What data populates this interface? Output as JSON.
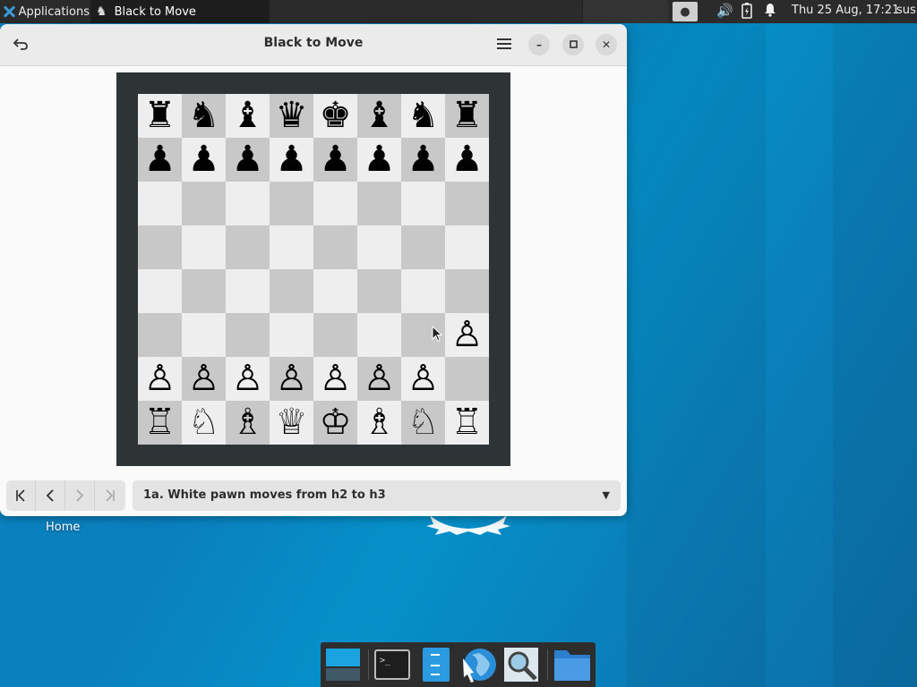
{
  "top_panel": {
    "applications_label": "Applications",
    "task_title": "Black to Move",
    "clock": "Thu 25 Aug, 17:21",
    "user": "sus"
  },
  "window": {
    "title": "Black to Move",
    "back_icon": "undo-arrow-icon",
    "menu_icon": "hamburger-menu-icon",
    "minimize_glyph": "–",
    "maximize_glyph": "□",
    "close_glyph": "✕"
  },
  "board": {
    "rows": [
      [
        "♜",
        "♞",
        "♝",
        "♛",
        "♚",
        "♝",
        "♞",
        "♜"
      ],
      [
        "♟",
        "♟",
        "♟",
        "♟",
        "♟",
        "♟",
        "♟",
        "♟"
      ],
      [
        "",
        "",
        "",
        "",
        "",
        "",
        "",
        ""
      ],
      [
        "",
        "",
        "",
        "",
        "",
        "",
        "",
        ""
      ],
      [
        "",
        "",
        "",
        "",
        "",
        "",
        "",
        ""
      ],
      [
        "",
        "",
        "",
        "",
        "",
        "",
        "",
        "♙"
      ],
      [
        "♙",
        "♙",
        "♙",
        "♙",
        "♙",
        "♙",
        "♙",
        ""
      ],
      [
        "♖",
        "♘",
        "♗",
        "♕",
        "♔",
        "♗",
        "♘",
        "♖"
      ]
    ],
    "colors": {
      "light": "#eeeeee",
      "dark": "#c8c8c8",
      "frame": "#2e3436"
    }
  },
  "navigation": {
    "first_glyph": "K",
    "prev_glyph": "<",
    "next_glyph": ">",
    "last_glyph": ">|"
  },
  "move_selector": {
    "selected": "1a. White pawn moves from h2 to h3"
  },
  "desktop": {
    "home_label": "Home"
  }
}
